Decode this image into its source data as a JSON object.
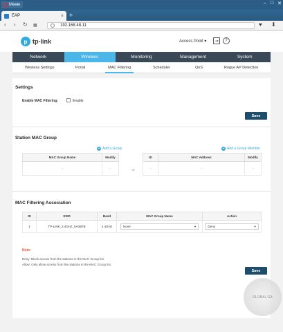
{
  "browser": {
    "menu_label": "Меню",
    "tab_title": "EAP",
    "url": "192.168.48.11"
  },
  "header": {
    "logo_text": "tp-link",
    "mode_label": "Access Point"
  },
  "main_nav": [
    "Network",
    "Wireless",
    "Monitoring",
    "Management",
    "System"
  ],
  "sub_nav": [
    "Wireless Settings",
    "Portal",
    "MAC Filtering",
    "Scheduler",
    "QoS",
    "Rogue AP Detection"
  ],
  "settings": {
    "title": "Settings",
    "enable_label": "Enable MAC Filtering:",
    "enable_option": "Enable",
    "save": "Save"
  },
  "station_group": {
    "title": "Station MAC Group",
    "add_group": "Add a Group",
    "add_member": "Add a Group Member",
    "left_headers": [
      "MAC Group Name",
      "Modify"
    ],
    "left_row": [
      "--",
      "--"
    ],
    "right_headers": [
      "ID",
      "MAC Address",
      "Modify"
    ],
    "right_row": [
      "--",
      "--",
      "--"
    ]
  },
  "association": {
    "title": "MAC Filtering Association",
    "headers": [
      "ID",
      "SSID",
      "Band",
      "MAC Group Name",
      "Action"
    ],
    "row": {
      "id": "1",
      "ssid": "TP-LINK_2.4GHz_0A0BFB",
      "band": "2.4GHz",
      "group": "None",
      "action": "Deny"
    },
    "note_title": "Note:",
    "note_lines": [
      "Deny: Block access from the stations in the MAC Group list.",
      "Allow: Only allow access from the stations in the MAC Group list."
    ],
    "save": "Save"
  },
  "watermark": "GLOBAL GA"
}
